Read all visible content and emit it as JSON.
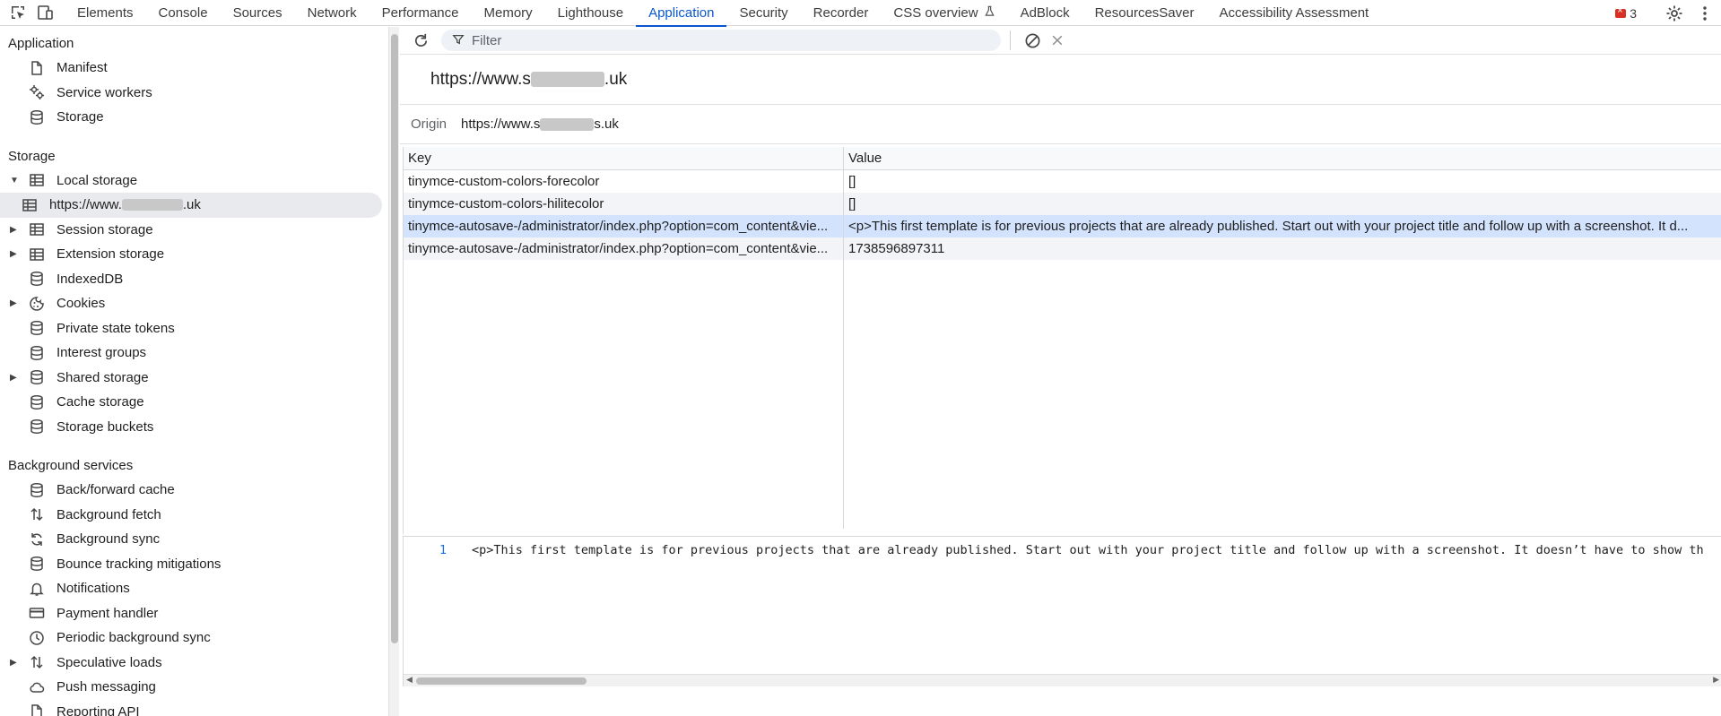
{
  "toolbar": {
    "tabs": [
      "Elements",
      "Console",
      "Sources",
      "Network",
      "Performance",
      "Memory",
      "Lighthouse",
      "Application",
      "Security",
      "Recorder",
      "CSS overview",
      "AdBlock",
      "ResourcesSaver",
      "Accessibility Assessment"
    ],
    "active_tab": "Application",
    "error_count": "3"
  },
  "sidebar": {
    "application_title": "Application",
    "application_items": [
      {
        "label": "Manifest",
        "icon": "file-icon"
      },
      {
        "label": "Service workers",
        "icon": "gears-icon"
      },
      {
        "label": "Storage",
        "icon": "database-icon"
      }
    ],
    "storage_title": "Storage",
    "storage_items": [
      {
        "label": "Local storage",
        "icon": "table-icon",
        "arrow": "down"
      },
      {
        "label": "https://www.",
        "suffix": ".uk",
        "icon": "table-icon",
        "sub": true,
        "selected": true
      },
      {
        "label": "Session storage",
        "icon": "table-icon",
        "arrow": "right"
      },
      {
        "label": "Extension storage",
        "icon": "table-icon",
        "arrow": "right"
      },
      {
        "label": "IndexedDB",
        "icon": "database-icon"
      },
      {
        "label": "Cookies",
        "icon": "cookie-icon",
        "arrow": "right"
      },
      {
        "label": "Private state tokens",
        "icon": "database-icon"
      },
      {
        "label": "Interest groups",
        "icon": "database-icon"
      },
      {
        "label": "Shared storage",
        "icon": "database-icon",
        "arrow": "right"
      },
      {
        "label": "Cache storage",
        "icon": "database-icon"
      },
      {
        "label": "Storage buckets",
        "icon": "database-icon"
      }
    ],
    "background_title": "Background services",
    "background_items": [
      {
        "label": "Back/forward cache",
        "icon": "database-icon"
      },
      {
        "label": "Background fetch",
        "icon": "updown-arrows-icon"
      },
      {
        "label": "Background sync",
        "icon": "sync-icon"
      },
      {
        "label": "Bounce tracking mitigations",
        "icon": "database-icon"
      },
      {
        "label": "Notifications",
        "icon": "bell-icon"
      },
      {
        "label": "Payment handler",
        "icon": "card-icon"
      },
      {
        "label": "Periodic background sync",
        "icon": "clock-icon"
      },
      {
        "label": "Speculative loads",
        "icon": "updown-arrows-icon",
        "arrow": "right"
      },
      {
        "label": "Push messaging",
        "icon": "cloud-icon"
      },
      {
        "label": "Reporting API",
        "icon": "file-icon"
      }
    ]
  },
  "main": {
    "filter_placeholder": "Filter",
    "origin_title_prefix": "https://www.s",
    "origin_title_suffix": ".uk",
    "origin_label": "Origin",
    "origin_value_prefix": "https://www.s",
    "origin_value_suffix": "s.uk",
    "table": {
      "headers": [
        "Key",
        "Value"
      ],
      "rows": [
        {
          "key": "tinymce-custom-colors-forecolor",
          "value": "[]"
        },
        {
          "key": "tinymce-custom-colors-hilitecolor",
          "value": "[]"
        },
        {
          "key": "tinymce-autosave-/administrator/index.php?option=com_content&vie...",
          "value": "<p>This first template is for previous projects that are already published. Start out with your project title and follow up with a screenshot. It d..."
        },
        {
          "key": "tinymce-autosave-/administrator/index.php?option=com_content&vie...",
          "value": "1738596897311"
        }
      ],
      "selected_row": 2
    },
    "viewer": {
      "line_number": "1",
      "code": "<p>This first template is for previous projects that are already published. Start out with your project title and follow up with a screenshot. It doesn’t have to show th"
    }
  }
}
